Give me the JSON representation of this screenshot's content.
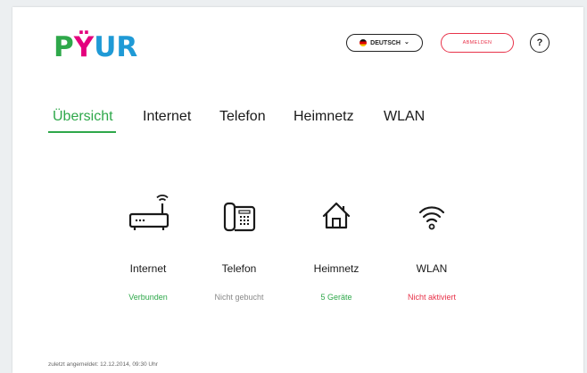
{
  "brand": {
    "logo": [
      "P",
      "Ÿ",
      "UR"
    ]
  },
  "header": {
    "language": {
      "label": "DEUTSCH",
      "icon": "chevron-down-icon"
    },
    "logout_label": "ABMELDEN",
    "help_label": "?"
  },
  "tabs": [
    {
      "label": "Übersicht",
      "active": true
    },
    {
      "label": "Internet"
    },
    {
      "label": "Telefon"
    },
    {
      "label": "Heimnetz"
    },
    {
      "label": "WLAN"
    }
  ],
  "tiles": [
    {
      "icon": "router-icon",
      "label": "Internet",
      "status": "Verbunden",
      "status_color": "#2ea84a"
    },
    {
      "icon": "phone-icon",
      "label": "Telefon",
      "status": "Nicht gebucht",
      "status_color": "#8a8a8a"
    },
    {
      "icon": "home-icon",
      "label": "Heimnetz",
      "status": "5 Geräte",
      "status_color": "#2ea84a"
    },
    {
      "icon": "wifi-icon",
      "label": "WLAN",
      "status": "Nicht aktiviert",
      "status_color": "#e8334a"
    }
  ],
  "footer": {
    "last_login": "zuletzt angemeldet: 12.12.2014, 09:30 Uhr"
  },
  "colors": {
    "accent": "#2ea84a",
    "danger": "#e8334a",
    "brand_pink": "#e4007d",
    "brand_blue": "#1f9ad6"
  }
}
